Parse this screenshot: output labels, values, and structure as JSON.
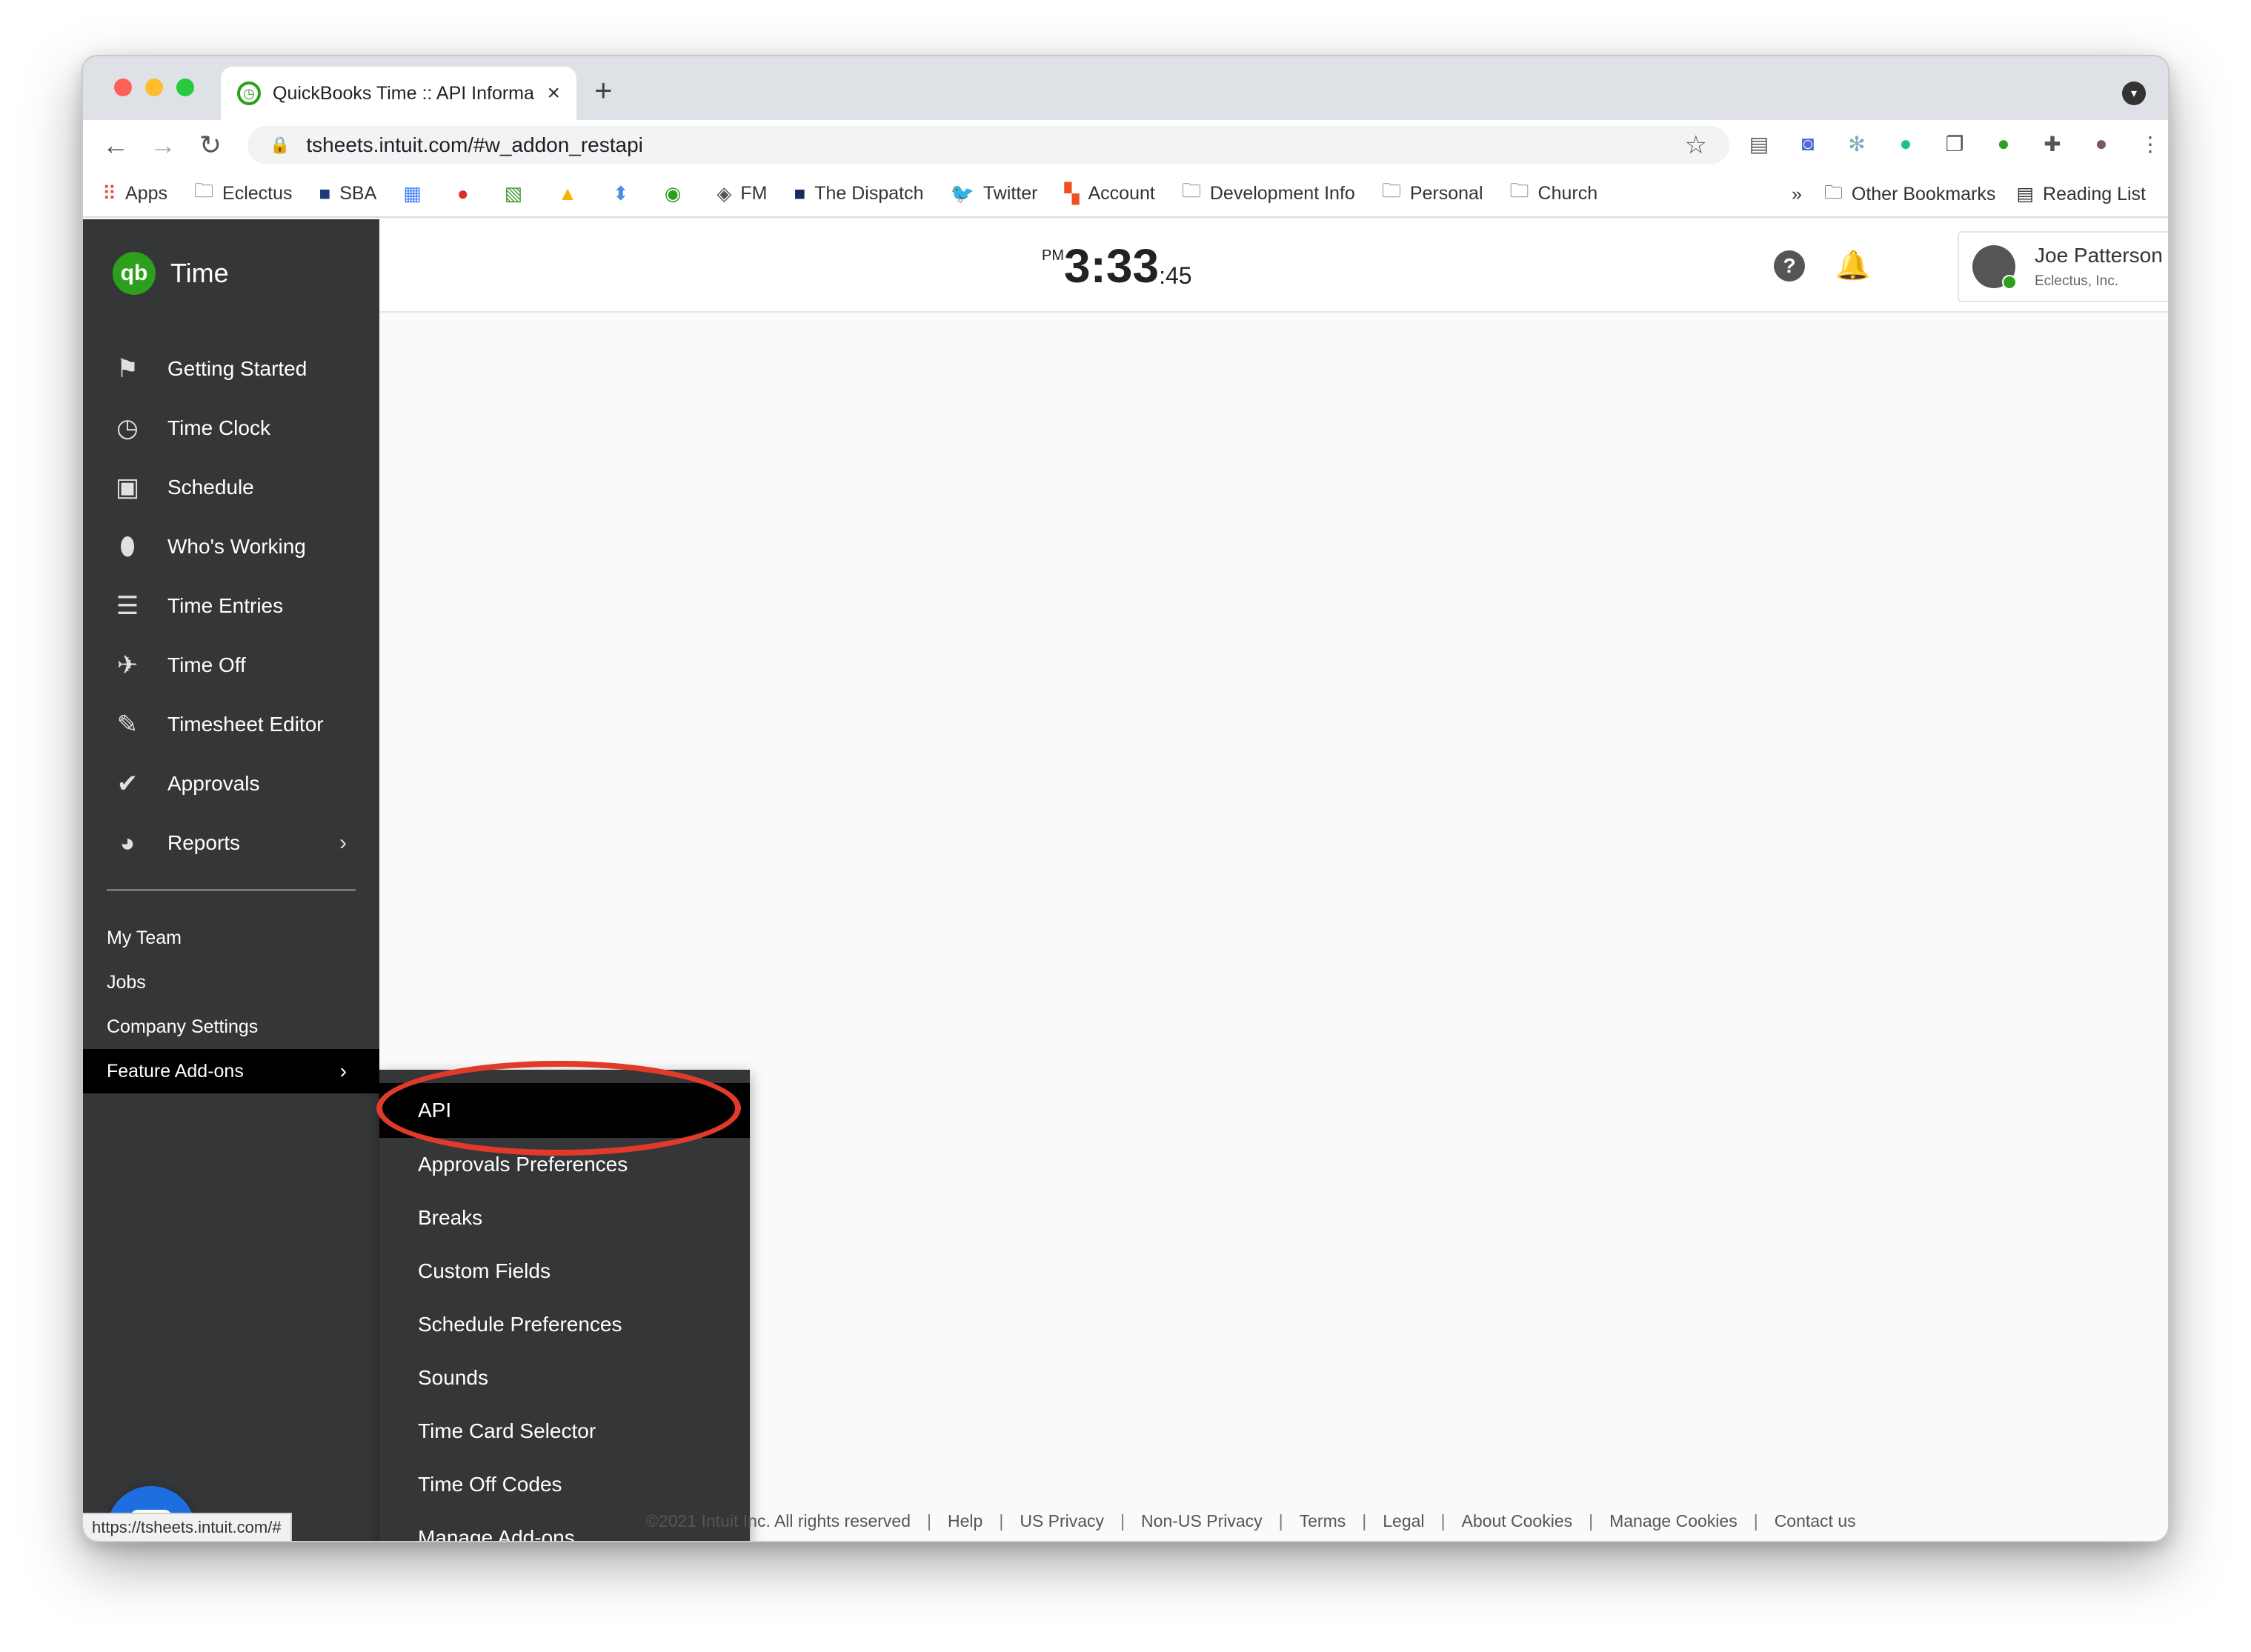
{
  "browser": {
    "tab_title": "QuickBooks Time :: API Informa",
    "url": "tsheets.intuit.com/#w_addon_restapi",
    "status_url": "https://tsheets.intuit.com/#",
    "new_tab": "+",
    "tab_close": "×"
  },
  "bookmarks": {
    "items": [
      {
        "label": "Apps",
        "icon": "apps-grid-icon"
      },
      {
        "label": "Eclectus",
        "icon": "folder-icon"
      },
      {
        "label": "SBA",
        "icon": "sba-icon"
      },
      {
        "label": "",
        "icon": "calendar-icon"
      },
      {
        "label": "",
        "icon": "t-icon"
      },
      {
        "label": "",
        "icon": "sheet-icon"
      },
      {
        "label": "",
        "icon": "drive-icon"
      },
      {
        "label": "",
        "icon": "arrow-icon"
      },
      {
        "label": "",
        "icon": "eye-icon"
      },
      {
        "label": "FM",
        "icon": "fm-icon"
      },
      {
        "label": "The Dispatch",
        "icon": "dispatch-icon"
      },
      {
        "label": "Twitter",
        "icon": "twitter-icon"
      },
      {
        "label": "Account",
        "icon": "microsoft-icon"
      },
      {
        "label": "Development Info",
        "icon": "folder-icon"
      },
      {
        "label": "Personal",
        "icon": "folder-icon"
      },
      {
        "label": "Church",
        "icon": "folder-icon"
      }
    ],
    "overflow": "»",
    "other": "Other Bookmarks",
    "reading_list": "Reading List"
  },
  "app": {
    "brand_logo": "qb",
    "brand_name": "Time",
    "nav": [
      {
        "label": "Getting Started",
        "icon": "flag-icon",
        "glyph": "⚑"
      },
      {
        "label": "Time Clock",
        "icon": "clock-icon",
        "glyph": "◷"
      },
      {
        "label": "Schedule",
        "icon": "calendar-icon",
        "glyph": "▣"
      },
      {
        "label": "Who's Working",
        "icon": "map-pin-icon",
        "glyph": "⬮"
      },
      {
        "label": "Time Entries",
        "icon": "time-entries-icon",
        "glyph": "☰"
      },
      {
        "label": "Time Off",
        "icon": "airplane-icon",
        "glyph": "✈"
      },
      {
        "label": "Timesheet Editor",
        "icon": "document-edit-icon",
        "glyph": "✎"
      },
      {
        "label": "Approvals",
        "icon": "double-check-icon",
        "glyph": "✔"
      },
      {
        "label": "Reports",
        "icon": "pie-chart-icon",
        "glyph": "◕"
      }
    ],
    "chevron": "›",
    "sub_nav": [
      "My Team",
      "Jobs",
      "Company Settings",
      "Feature Add-ons"
    ],
    "clock": {
      "ampm": "PM",
      "hm": "3:33",
      "sec": ":45"
    },
    "help_icon_glyph": "?",
    "bell_glyph": "🔔",
    "user": {
      "name": "Joe Patterson",
      "company": "Eclectus, Inc."
    },
    "addons_menu": [
      "API",
      "Approvals Preferences",
      "Breaks",
      "Custom Fields",
      "Schedule Preferences",
      "Sounds",
      "Time Card Selector",
      "Time Off Codes",
      "Manage Add-ons"
    ],
    "footer": [
      "©2021 Intuit Inc. All rights reserved",
      "Help",
      "US Privacy",
      "Non-US Privacy",
      "Terms",
      "Legal",
      "About Cookies",
      "Manage Cookies",
      "Contact us"
    ],
    "footer_sep": "|"
  },
  "colors": {
    "brand_green": "#2ca01c",
    "sidebar": "#353638",
    "highlight_ring": "#e03a2a",
    "help_blue": "#1d6fe0"
  }
}
